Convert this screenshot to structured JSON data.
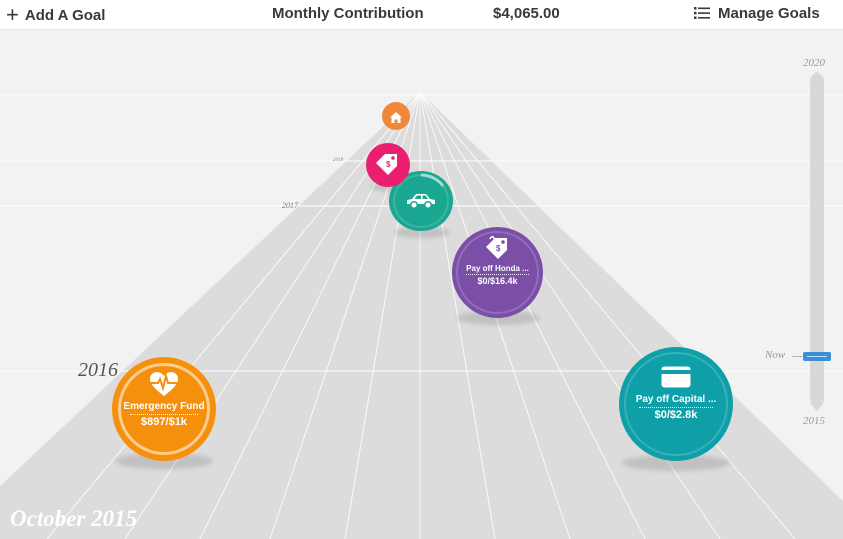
{
  "header": {
    "add_goal_label": "Add A Goal",
    "contribution_label": "Monthly Contribution",
    "contribution_value": "$4,065.00",
    "manage_label": "Manage Goals"
  },
  "road": {
    "year_labels": [
      "2016",
      "2017",
      "2018"
    ],
    "current_month": "October 2015"
  },
  "goals": [
    {
      "id": "emergency",
      "name": "Emergency Fund",
      "amount": "$897/$1k",
      "icon": "heart-pulse-icon",
      "color": "#f5900d",
      "progress": 0.897
    },
    {
      "id": "capital",
      "name": "Pay off Capital ...",
      "amount": "$0/$2.8k",
      "icon": "credit-card-icon",
      "color": "#0e9fa8",
      "progress": 0
    },
    {
      "id": "honda",
      "name": "Pay off Honda ...",
      "amount": "$0/$16.4k",
      "icon": "price-tag-icon",
      "color": "#7b4ea8",
      "progress": 0
    },
    {
      "id": "car",
      "icon": "car-icon",
      "color": "#1aa791"
    },
    {
      "id": "tag",
      "icon": "price-tag-icon",
      "color": "#ea1f6f"
    },
    {
      "id": "home",
      "icon": "home-icon",
      "color": "#f0883a"
    }
  ],
  "timeline": {
    "top_label": "2020",
    "bottom_label": "2015",
    "now_label": "Now"
  }
}
